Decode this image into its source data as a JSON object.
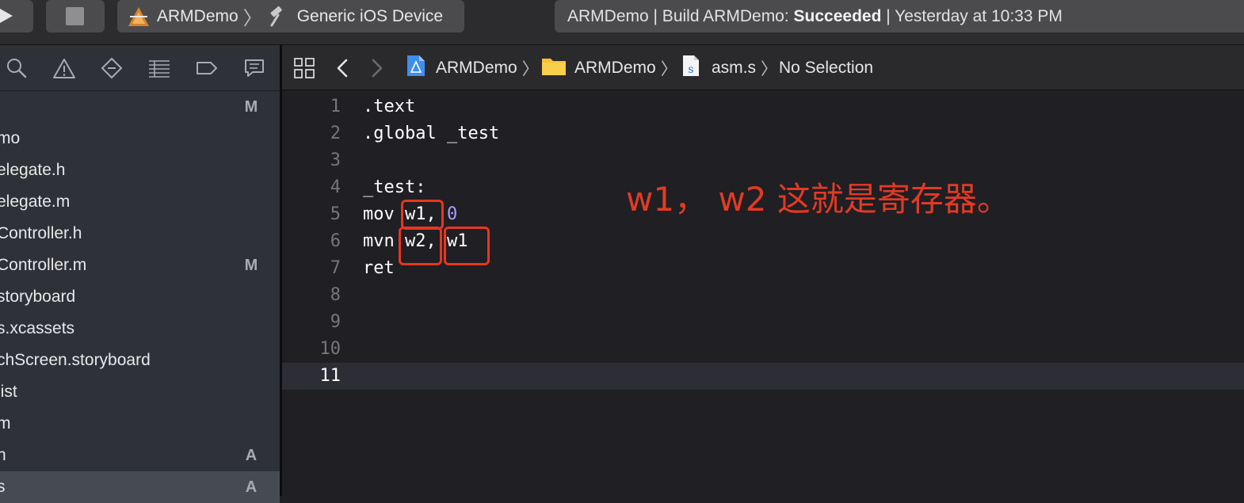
{
  "toolbar": {
    "scheme": {
      "project": "ARMDemo",
      "device": "Generic iOS Device"
    },
    "status": {
      "prefix": "ARMDemo | Build ARMDemo: ",
      "result": "Succeeded",
      "suffix": " | Yesterday at 10:33 PM"
    }
  },
  "navigator": {
    "tabs": [
      "search-icon",
      "warning-icon",
      "breakpoint-diamond-icon",
      "list-icon",
      "tag-icon",
      "comment-icon"
    ],
    "header_badge": "M",
    "files": [
      {
        "name": "mo",
        "badge": ""
      },
      {
        "name": "elegate.h",
        "badge": ""
      },
      {
        "name": "elegate.m",
        "badge": ""
      },
      {
        "name": "Controller.h",
        "badge": ""
      },
      {
        "name": "Controller.m",
        "badge": "M"
      },
      {
        "name": "storyboard",
        "badge": ""
      },
      {
        "name": "s.xcassets",
        "badge": ""
      },
      {
        "name": "chScreen.storyboard",
        "badge": ""
      },
      {
        "name": "list",
        "badge": ""
      },
      {
        "name": "m",
        "badge": ""
      },
      {
        "name": "h",
        "badge": "A"
      },
      {
        "name": "s",
        "badge": "A"
      }
    ]
  },
  "jumpbar": {
    "project": "ARMDemo",
    "group": "ARMDemo",
    "file": "asm.s",
    "symbol": "No Selection"
  },
  "editor": {
    "lines": [
      {
        "n": "1",
        "code": ".text"
      },
      {
        "n": "2",
        "code": ".global _test"
      },
      {
        "n": "3",
        "code": ""
      },
      {
        "n": "4",
        "code": "_test:"
      },
      {
        "n": "5",
        "code": "mov w1, ",
        "num": "0"
      },
      {
        "n": "6",
        "code": "mvn w2, w1"
      },
      {
        "n": "7",
        "code": "ret"
      },
      {
        "n": "8",
        "code": ""
      },
      {
        "n": "9",
        "code": ""
      },
      {
        "n": "10",
        "code": ""
      },
      {
        "n": "11",
        "code": ""
      }
    ],
    "current_line": "11",
    "annotation": "w1， w2 这就是寄存器。"
  },
  "colors": {
    "annotation": "#e33a23",
    "number_literal": "#b19bff",
    "editor_bg": "#1f1f24"
  }
}
